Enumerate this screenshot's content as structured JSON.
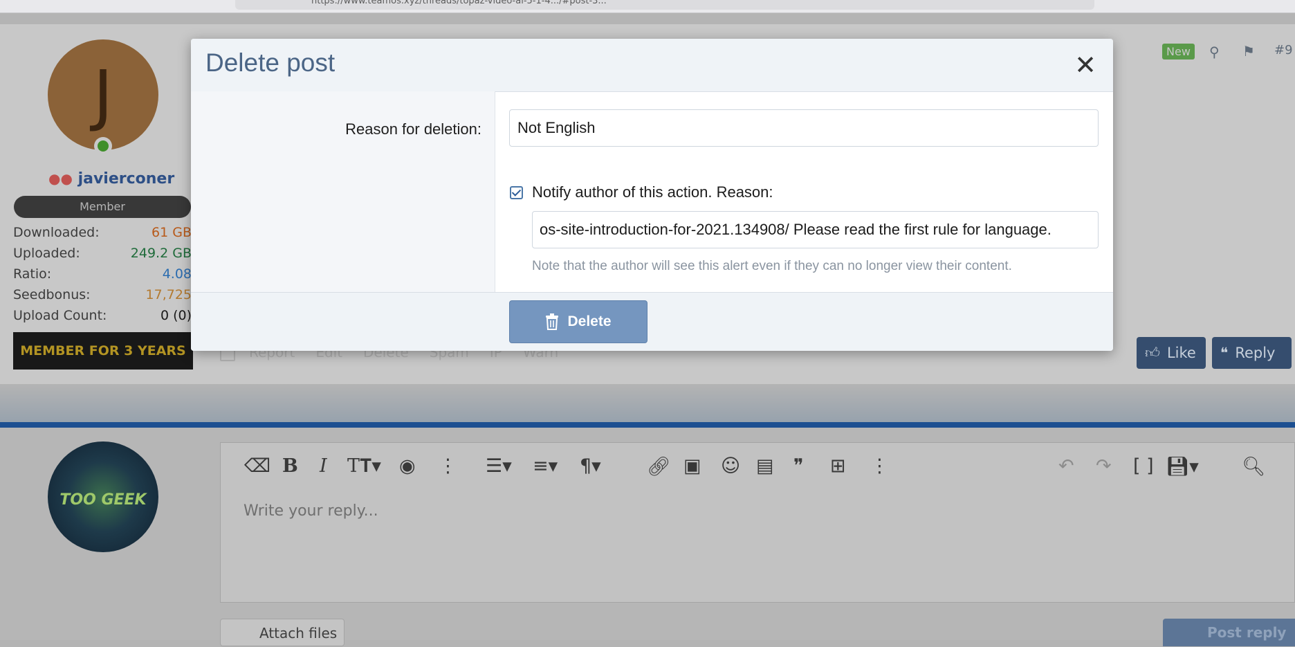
{
  "browser": {
    "url": "https://www.teamos.xyz/threads/topaz-video-ai-5-1-4.../#post-3..."
  },
  "post": {
    "author": {
      "avatar_letter": "J",
      "username": "javierconer",
      "role": "Member",
      "stats": [
        {
          "label": "Downloaded:",
          "value": "61 GB",
          "color": "#b85a1a"
        },
        {
          "label": "Uploaded:",
          "value": "249.2 GB",
          "color": "#1f6b3a"
        },
        {
          "label": "Ratio:",
          "value": "4.08",
          "color": "#2a6cb0"
        },
        {
          "label": "Seedbonus:",
          "value": "17,725",
          "color": "#b37a30"
        },
        {
          "label": "Upload Count:",
          "value": "0 (0)",
          "color": "#1a1a1a"
        }
      ],
      "tenure_badge": "MEMBER FOR 3 YEARS"
    },
    "header": {
      "new_label": "New",
      "post_number": "#9"
    },
    "actions": [
      "Report",
      "Edit",
      "Delete",
      "Spam",
      "IP",
      "Warn"
    ],
    "like_label": "Like",
    "reply_label": "Reply"
  },
  "reply_editor": {
    "avatar_text": "TOO GEEK",
    "placeholder": "Write your reply...",
    "attach_label": "Attach files",
    "post_reply_label": "Post reply"
  },
  "dialog": {
    "title": "Delete post",
    "reason_label": "Reason for deletion:",
    "reason_value": "Not English",
    "notify_checked": true,
    "notify_label": "Notify author of this action. Reason:",
    "notify_reason": "os-site-introduction-for-2021.134908/      Please read the first rule for language.",
    "note": "Note that the author will see this alert even if they can no longer view their content.",
    "delete_label": "Delete"
  }
}
